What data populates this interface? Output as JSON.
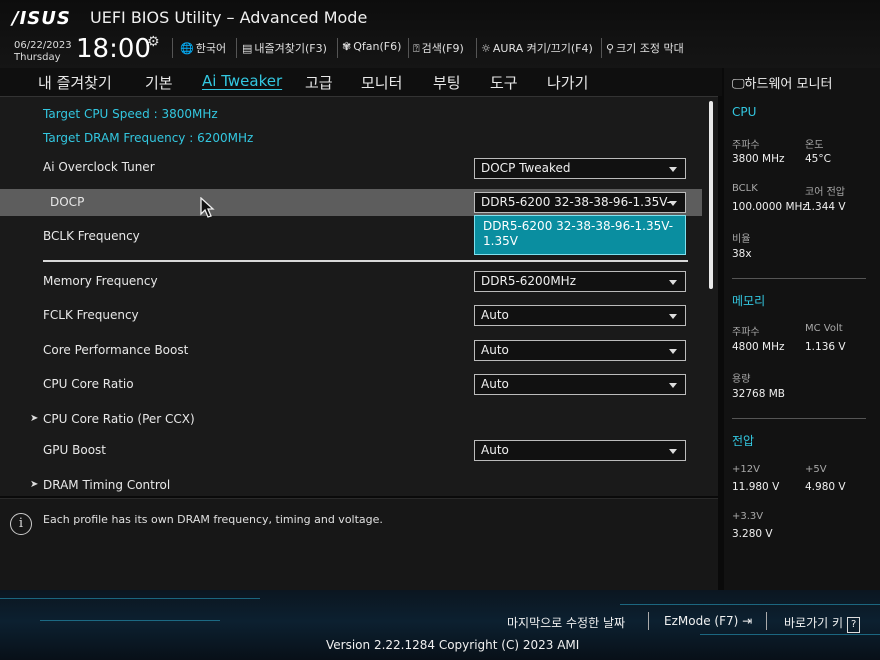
{
  "header": {
    "logo": "/ISUS",
    "title": "UEFI BIOS Utility – Advanced Mode",
    "date": "06/22/2023",
    "day": "Thursday",
    "time": "18:00",
    "tools": {
      "language": "한국어",
      "favorites": "내즐겨찾기(F3)",
      "qfan": "Qfan(F6)",
      "search": "검색(F9)",
      "aura": "AURA 켜기/끄기(F4)",
      "resize": "크기 조정 막대"
    }
  },
  "tabs": [
    "내 즐겨찾기",
    "기본",
    "Ai Tweaker",
    "고급",
    "모니터",
    "부팅",
    "도구",
    "나가기"
  ],
  "active_tab": "Ai Tweaker",
  "main": {
    "target_cpu": "Target CPU Speed : 3800MHz",
    "target_dram": "Target DRAM Frequency : 6200MHz",
    "rows": {
      "ai_overclock": {
        "label": "Ai Overclock Tuner",
        "value": "DOCP Tweaked"
      },
      "docp": {
        "label": "DOCP",
        "value": "DDR5-6200 32-38-38-96-1.35V-"
      },
      "bclk": {
        "label": "BCLK Frequency"
      },
      "memory_freq": {
        "label": "Memory Frequency",
        "value": "DDR5-6200MHz"
      },
      "fclk": {
        "label": "FCLK Frequency",
        "value": "Auto"
      },
      "cpb": {
        "label": "Core Performance Boost",
        "value": "Auto"
      },
      "core_ratio": {
        "label": "CPU Core Ratio",
        "value": "Auto"
      },
      "core_ratio_ccx": {
        "label": "CPU Core Ratio (Per CCX)"
      },
      "gpu_boost": {
        "label": "GPU Boost",
        "value": "Auto"
      },
      "dram_timing": {
        "label": "DRAM Timing Control"
      }
    },
    "dropdown_option": "DDR5-6200 32-38-38-96-1.35V-1.35V"
  },
  "help": {
    "text": "Each profile has its own DRAM frequency, timing and voltage."
  },
  "hw_monitor": {
    "title": "하드웨어 모니터",
    "cpu": {
      "section": "CPU",
      "freq_label": "주파수",
      "freq": "3800 MHz",
      "temp_label": "온도",
      "temp": "45°C",
      "bclk_label": "BCLK",
      "bclk": "100.0000 MHz",
      "vcore_label": "코어 전압",
      "vcore": "1.344 V",
      "ratio_label": "비율",
      "ratio": "38x"
    },
    "memory": {
      "section": "메모리",
      "freq_label": "주파수",
      "freq": "4800 MHz",
      "volt_label": "MC Volt",
      "volt": "1.136 V",
      "cap_label": "용량",
      "cap": "32768 MB"
    },
    "voltage": {
      "section": "전압",
      "v12_label": "+12V",
      "v12": "11.980 V",
      "v5_label": "+5V",
      "v5": "4.980 V",
      "v33_label": "+3.3V",
      "v33": "3.280 V"
    }
  },
  "footer": {
    "last_modified": "마지막으로 수정한 날짜",
    "ezmode": "EzMode (F7)",
    "hotkeys": "바로가기 키",
    "hotkeys_key": "?",
    "version": "Version 2.22.1284 Copyright (C) 2023 AMI"
  },
  "colors": {
    "accent": "#33c7e0",
    "highlight": "#5d5d5d",
    "dropdown_bg": "#0a8ea0"
  }
}
